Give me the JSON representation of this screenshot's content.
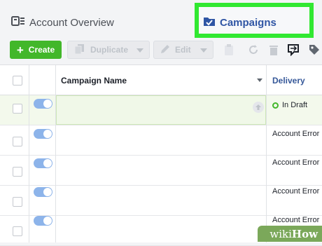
{
  "tabs": {
    "overview_label": "Account Overview",
    "campaigns_label": "Campaigns",
    "active": "Campaigns",
    "highlight_color": "#31e831"
  },
  "toolbar": {
    "create_label": "Create",
    "duplicate_label": "Duplicate",
    "edit_label": "Edit",
    "icons": [
      "clipboard-icon",
      "refresh-icon",
      "trash-icon",
      "review-changes-icon",
      "tag-icon"
    ]
  },
  "table": {
    "columns": [
      "Campaign Name",
      "Delivery"
    ],
    "rows": [
      {
        "delivery": "In Draft",
        "on": true
      },
      {
        "delivery": "Account Error",
        "on": true
      },
      {
        "delivery": "Account Error",
        "on": true
      },
      {
        "delivery": "Account Error",
        "on": true
      },
      {
        "delivery": "Account Error",
        "on": true
      }
    ]
  },
  "watermark": {
    "wiki": "wiki",
    "how": "How"
  },
  "colors": {
    "accent": "#42b72a",
    "link": "#365899",
    "toggle": "#8db4ea"
  }
}
